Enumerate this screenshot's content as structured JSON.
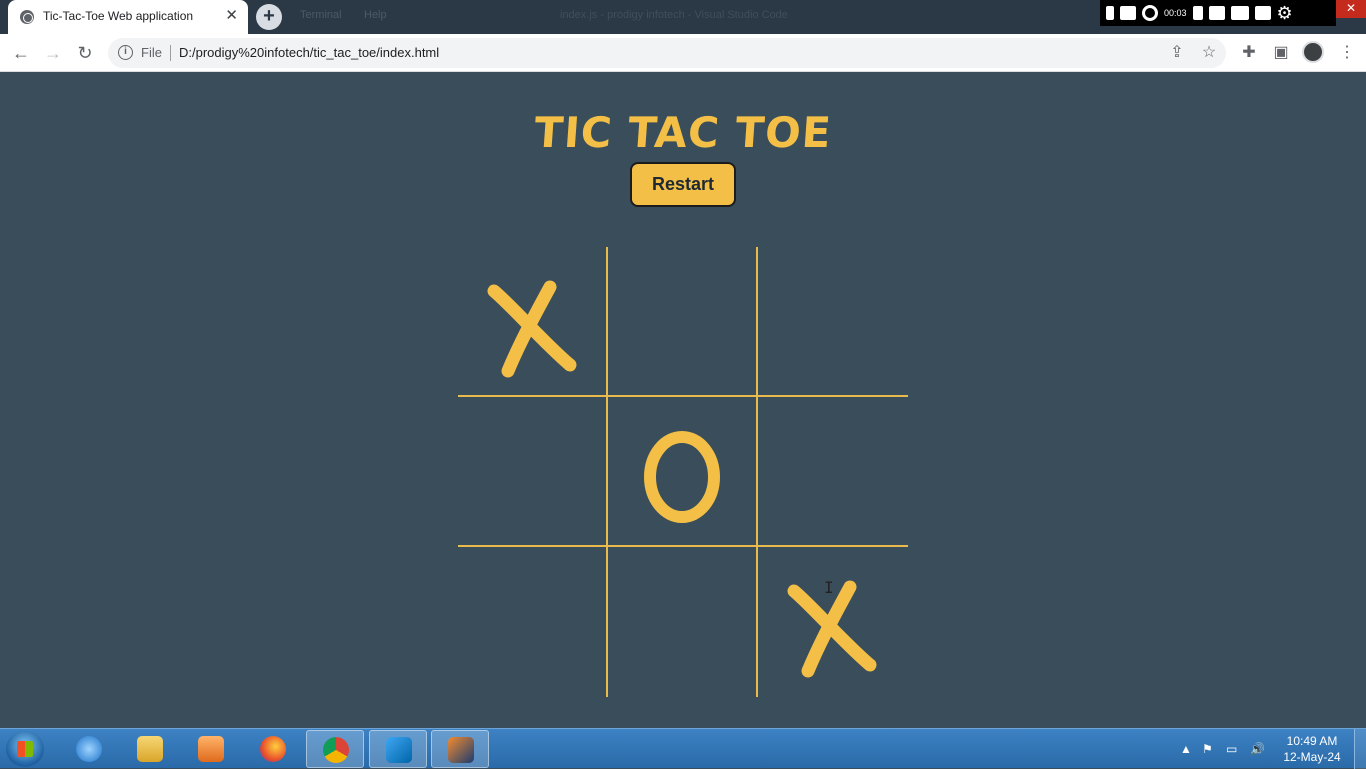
{
  "browser": {
    "tab_title": "Tic-Tac-Toe Web application",
    "ghost_menu": [
      "Terminal",
      "Help"
    ],
    "ghost_window_title": "index.js - prodigy infotech - Visual Studio Code",
    "scheme_label": "File",
    "url": "D:/prodigy%20infotech/tic_tac_toe/index.html",
    "recorder_time": "00:03"
  },
  "game": {
    "title": "TIC TAC TOE",
    "restart_label": "Restart",
    "board": [
      "X",
      "",
      "",
      "",
      "O",
      "",
      "",
      "",
      "X"
    ],
    "accent_color": "#f3bf46",
    "background_color": "#394d5b"
  },
  "taskbar": {
    "apps": [
      "internet-explorer",
      "file-explorer",
      "media-player",
      "firefox",
      "chrome",
      "vscode",
      "app-v"
    ],
    "time": "10:49 AM",
    "date": "12-May-24"
  }
}
